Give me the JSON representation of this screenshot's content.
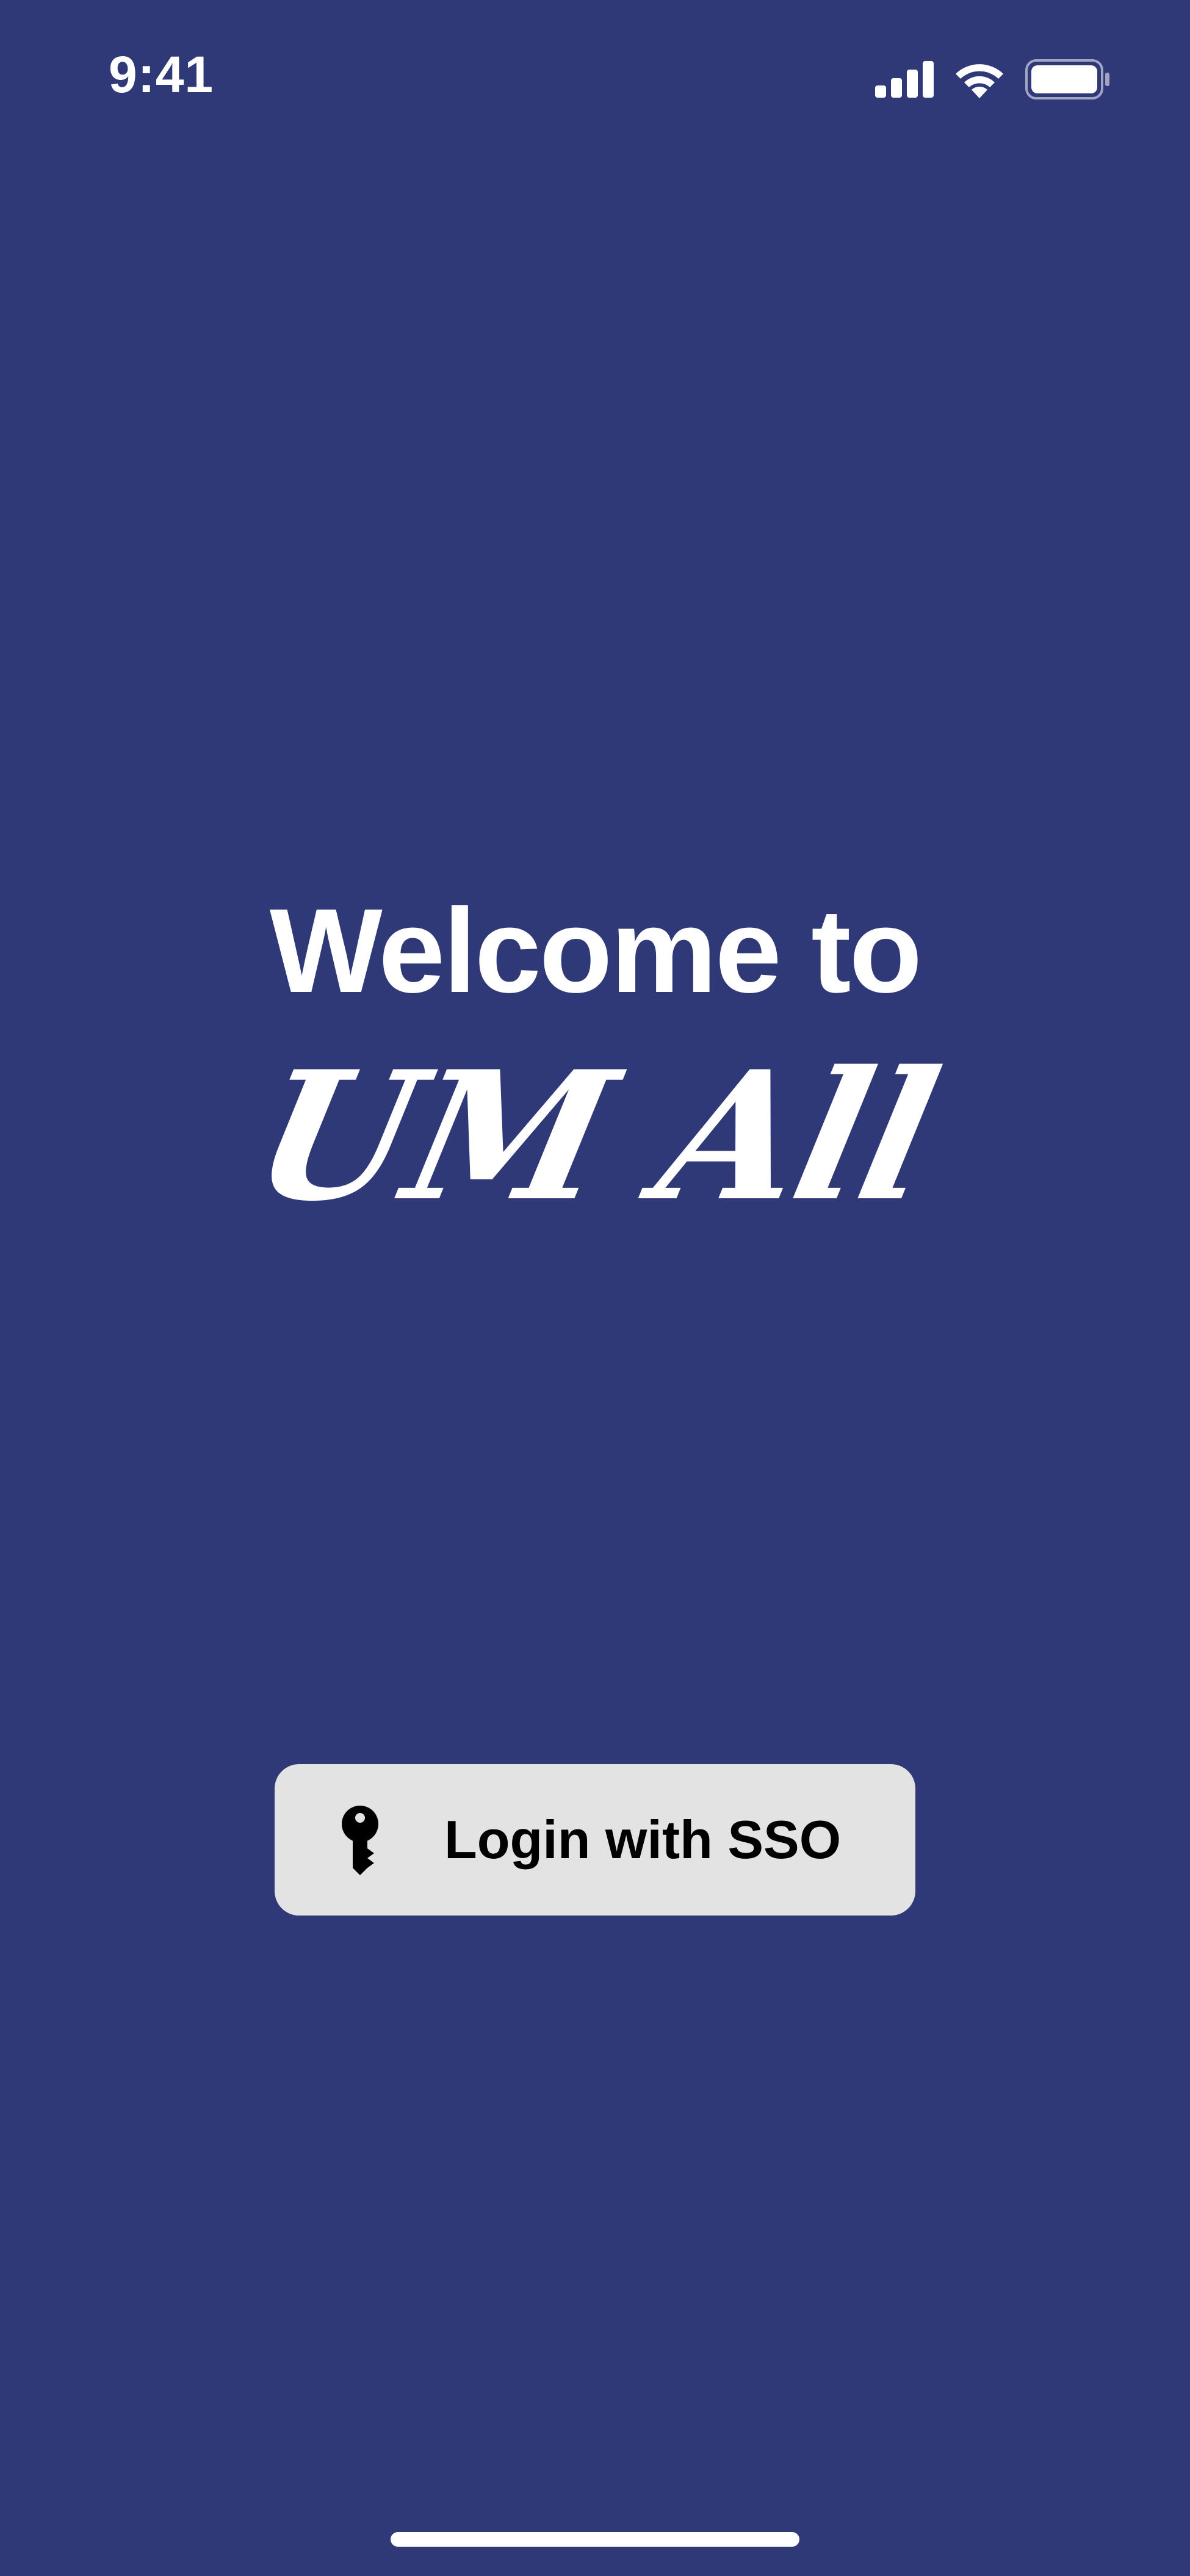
{
  "colors": {
    "background": "#2f3978",
    "text": "#ffffff",
    "button_background": "#e3e3e3",
    "button_text": "#000000",
    "home_indicator": "#ffffff"
  },
  "status_bar": {
    "time": "9:41",
    "icons": [
      "cellular-signal-icon",
      "wifi-icon",
      "battery-icon"
    ]
  },
  "welcome": {
    "title": "Welcome to",
    "app_name": "UM All"
  },
  "login": {
    "icon": "key-icon",
    "label": "Login with SSO"
  }
}
